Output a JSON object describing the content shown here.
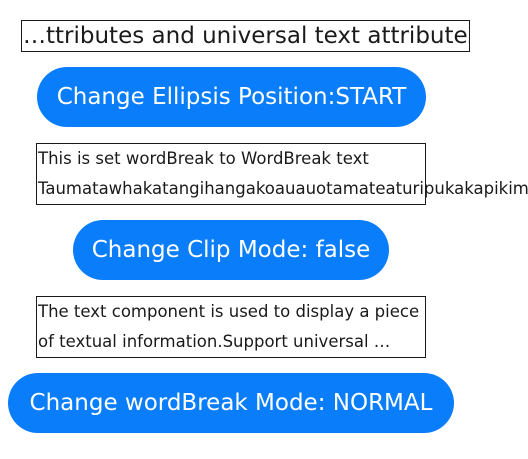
{
  "text_blocks": {
    "ellipsis_text": "…ttributes and universal text attributes.",
    "wordbreak_line1": "This is set wordBreak to WordBreak text",
    "wordbreak_line2": "Taumatawhakatangihangakoauauotamateaturipukakapikima",
    "clip_line1": "The text component is used to display a piece",
    "clip_line2": "of textual information.Support universal …"
  },
  "buttons": {
    "ellipsis_position": "Change Ellipsis Position:START",
    "clip_mode": "Change Clip Mode: false",
    "wordbreak_mode": "Change wordBreak Mode: NORMAL"
  },
  "colors": {
    "button_bg": "#0a7dfa",
    "button_text": "#ffffff",
    "border": "#1a1a1a"
  }
}
